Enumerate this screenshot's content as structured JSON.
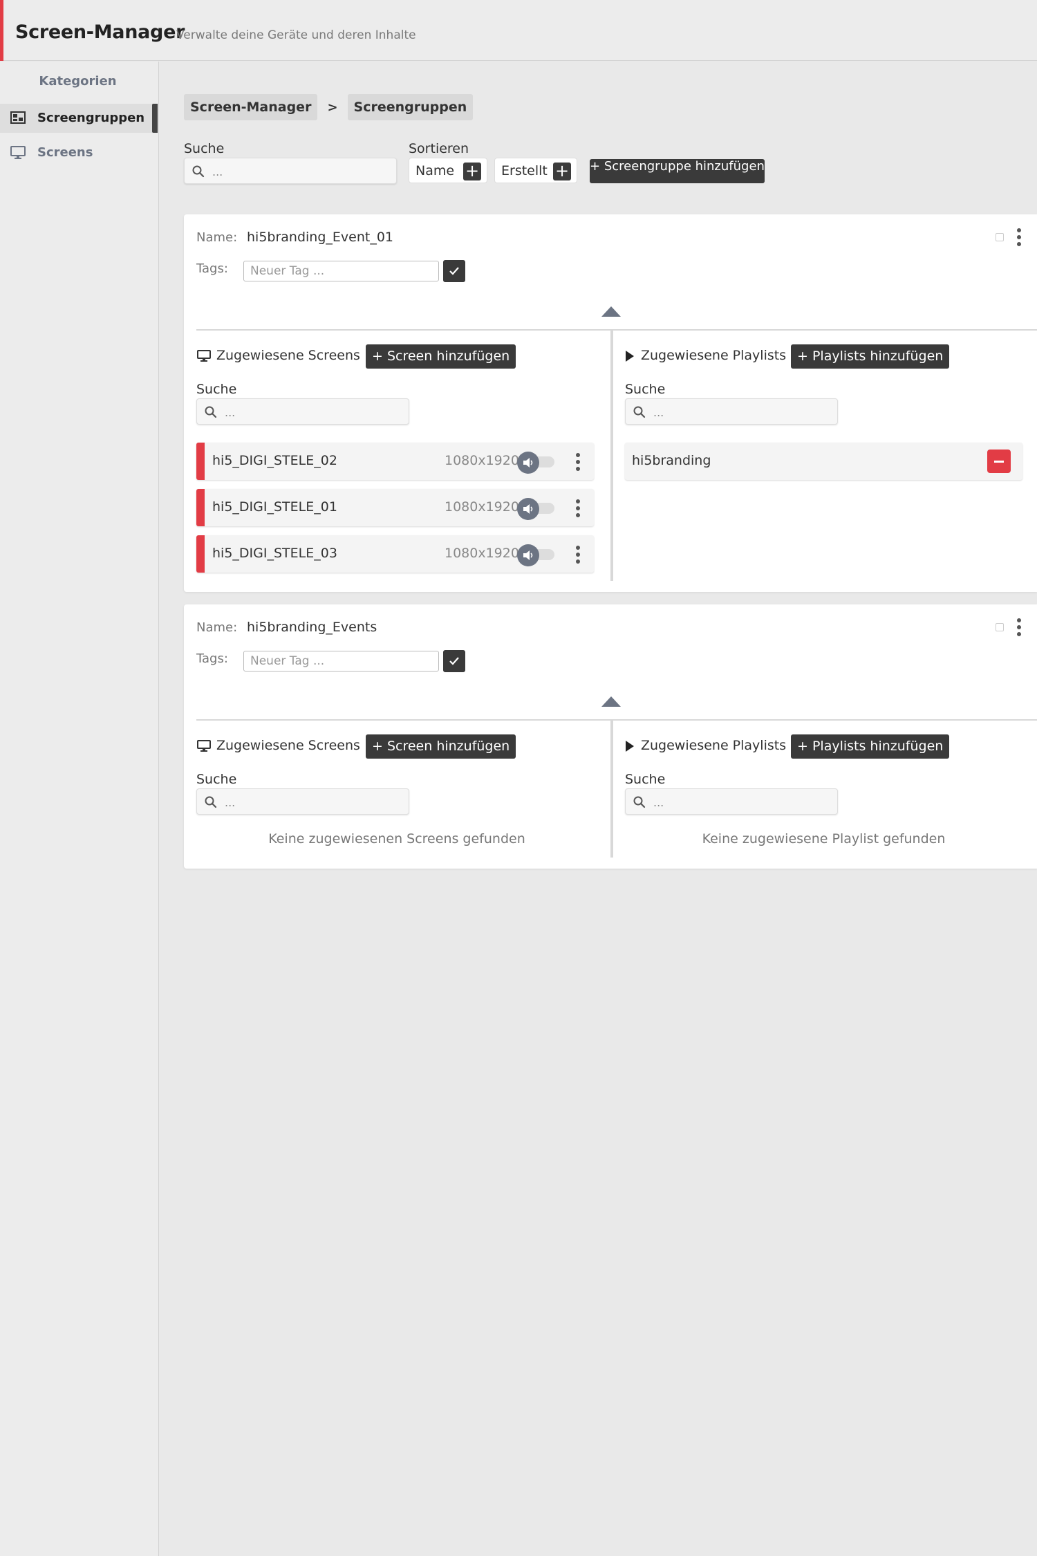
{
  "header": {
    "title": "Screen-Manager",
    "subtitle": "Verwalte deine Geräte und deren Inhalte",
    "accent_color": "#e23c45"
  },
  "sidebar": {
    "heading": "Kategorien",
    "items": [
      {
        "label": "Screengruppen",
        "icon": "screen-group-icon",
        "active": true
      },
      {
        "label": "Screens",
        "icon": "monitor-icon",
        "active": false
      }
    ]
  },
  "breadcrumb": {
    "items": [
      "Screen-Manager",
      "Screengruppen"
    ],
    "separator": ">"
  },
  "filters": {
    "search_label": "Suche",
    "search_placeholder": "...",
    "sort_label": "Sortieren",
    "sort_options": [
      "Name",
      "Erstellt"
    ],
    "add_group_label": "+ Screengruppe hinzufügen"
  },
  "groups": [
    {
      "name_label": "Name:",
      "name": "hi5branding_Event_01",
      "tags_label": "Tags:",
      "tag_placeholder": "Neuer Tag ...",
      "screens_title": "Zugewiesene Screens",
      "add_screen_label": "+ Screen hinzufügen",
      "screens_search_label": "Suche",
      "screens_search_placeholder": "...",
      "screens": [
        {
          "name": "hi5_DIGI_STELE_02",
          "resolution": "1080x1920"
        },
        {
          "name": "hi5_DIGI_STELE_01",
          "resolution": "1080x1920"
        },
        {
          "name": "hi5_DIGI_STELE_03",
          "resolution": "1080x1920"
        }
      ],
      "playlists_title": "Zugewiesene Playlists",
      "add_playlist_label": "+ Playlists hinzufügen",
      "playlists_search_label": "Suche",
      "playlists_search_placeholder": "...",
      "playlists": [
        {
          "name": "hi5branding"
        }
      ]
    },
    {
      "name_label": "Name:",
      "name": "hi5branding_Events",
      "tags_label": "Tags:",
      "tag_placeholder": "Neuer Tag ...",
      "screens_title": "Zugewiesene Screens",
      "add_screen_label": "+ Screen hinzufügen",
      "screens_search_label": "Suche",
      "screens_search_placeholder": "...",
      "screens_empty": "Keine zugewiesenen Screens gefunden",
      "playlists_title": "Zugewiesene Playlists",
      "add_playlist_label": "+ Playlists hinzufügen",
      "playlists_search_label": "Suche",
      "playlists_search_placeholder": "...",
      "playlists_empty": "Keine zugewiesene Playlist gefunden"
    }
  ]
}
